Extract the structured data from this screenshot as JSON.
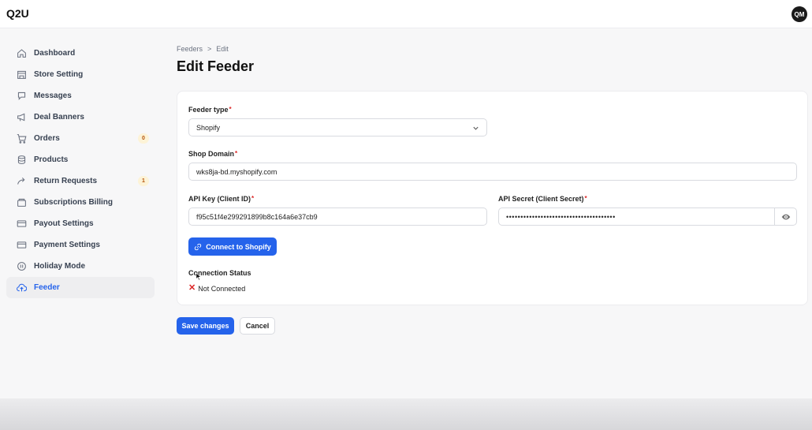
{
  "app": {
    "title": "Q2U",
    "avatar_initials": "QM"
  },
  "sidebar": {
    "items": [
      {
        "label": "Dashboard",
        "icon": "home-icon"
      },
      {
        "label": "Store Setting",
        "icon": "store-icon"
      },
      {
        "label": "Messages",
        "icon": "chat-icon"
      },
      {
        "label": "Deal Banners",
        "icon": "megaphone-icon"
      },
      {
        "label": "Orders",
        "icon": "cart-icon",
        "badge": "0"
      },
      {
        "label": "Products",
        "icon": "database-icon"
      },
      {
        "label": "Return Requests",
        "icon": "return-arrow-icon",
        "badge": "1"
      },
      {
        "label": "Subscriptions Billing",
        "icon": "billing-icon"
      },
      {
        "label": "Payout Settings",
        "icon": "card-icon"
      },
      {
        "label": "Payment Settings",
        "icon": "card-icon"
      },
      {
        "label": "Holiday Mode",
        "icon": "pause-icon"
      },
      {
        "label": "Feeder",
        "icon": "cloud-upload-icon",
        "active": true
      }
    ]
  },
  "breadcrumb": {
    "parent": "Feeders",
    "separator": ">",
    "current": "Edit"
  },
  "page": {
    "title": "Edit Feeder"
  },
  "form": {
    "feeder_type": {
      "label": "Feeder type",
      "required_mark": "*",
      "value": "Shopify"
    },
    "shop_domain": {
      "label": "Shop Domain",
      "required_mark": "*",
      "value": "wks8ja-bd.myshopify.com"
    },
    "api_key": {
      "label": "API Key (Client ID)",
      "required_mark": "*",
      "value": "f95c51f4e299291899b8c164a6e37cb9"
    },
    "api_secret": {
      "label": "API Secret (Client Secret)",
      "required_mark": "*",
      "value": "••••••••••••••••••••••••••••••••••••••"
    },
    "connect_button": "Connect to Shopify",
    "connection_status": {
      "label": "Connection Status",
      "value": "Not Connected",
      "icon": "cross-icon"
    }
  },
  "actions": {
    "save": "Save changes",
    "cancel": "Cancel"
  },
  "colors": {
    "accent": "#2563eb",
    "danger": "#dc2626",
    "badge_bg": "#fdf3d7",
    "badge_text": "#b45309"
  }
}
